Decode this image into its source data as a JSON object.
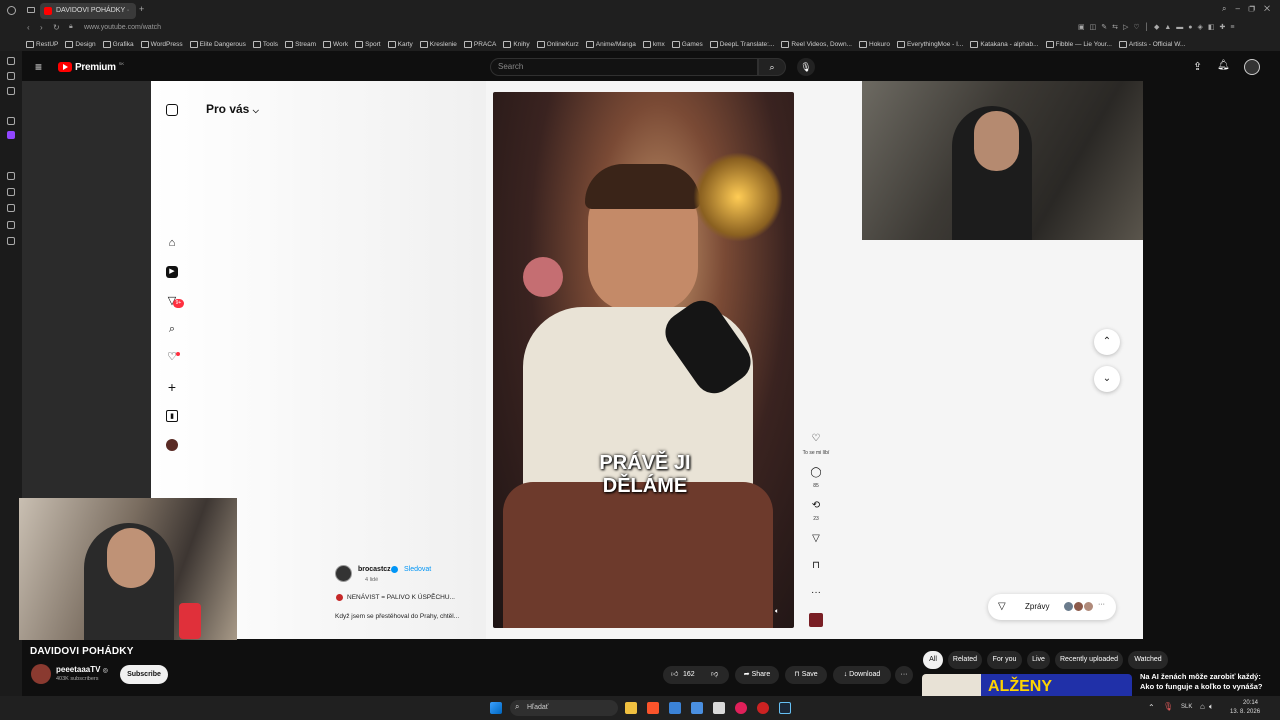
{
  "browser": {
    "tab_title": "DAVIDOVI POHÁDKY ·",
    "url": "www.youtube.com/watch",
    "bookmarks": [
      "RestUP",
      "Design",
      "Grafika",
      "WordPress",
      "Elite Dangerous",
      "Tools",
      "Stream",
      "Work",
      "Sport",
      "Karty",
      "Kreslenie",
      "PRACA",
      "Knihy",
      "OnlineKurz",
      "Anime/Manga",
      "kmx",
      "Games",
      "DeepL Translate:...",
      "Reel Videos, Down...",
      "Hokuro",
      "EverythingMoe - I...",
      "Katakana - alphab...",
      "Fibble — Lie Your...",
      "Artists - Official W..."
    ]
  },
  "youtube": {
    "logo": "Premium",
    "logo_badge": "SK",
    "search_placeholder": "Search"
  },
  "instagram": {
    "feed_label": "Pro vás",
    "feed_chevron": "⌵",
    "notif_badge": "9+",
    "caption_text": "PRÁVĚ JI DĚLÁME",
    "like_label": "To se mi líbí",
    "comment_count": "85",
    "repost_count": "23",
    "more_label": "···",
    "author": "brocastcz",
    "follow_label": "Sledovat",
    "audience": "4 lidé",
    "post_title": "NENÁVIST = PALIVO K ÚSPĚCHU...",
    "post_snippet": "Když jsem se přestěhoval do Prahy, chtěl...",
    "messages_label": "Zprávy",
    "messages_more": "···"
  },
  "video": {
    "title": "DAVIDOVI POHÁDKY",
    "channel": "peeetaaaTV",
    "verified": "◎",
    "subscribers": "403K subscribers",
    "subscribe_label": "Subscribe",
    "likes": "162",
    "share_label": "Share",
    "save_label": "Save",
    "download_label": "Download",
    "more_label": "···"
  },
  "recommendations": {
    "chips": [
      "All",
      "Related",
      "For you",
      "Live",
      "Recently uploaded",
      "Watched"
    ],
    "thumb_text": "ALŽENY",
    "next_title": "Na AI ženách môže zarobiť každý: Ako to funguje a koľko to vynáša?"
  },
  "taskbar": {
    "search_placeholder": "Hľadať",
    "lang": "SLK",
    "time": "20:14",
    "date": "13. 8. 2026"
  },
  "colors": {
    "yt_red": "#ff0000",
    "ig_badge": "#ff3040",
    "ig_link": "#0095f6"
  }
}
